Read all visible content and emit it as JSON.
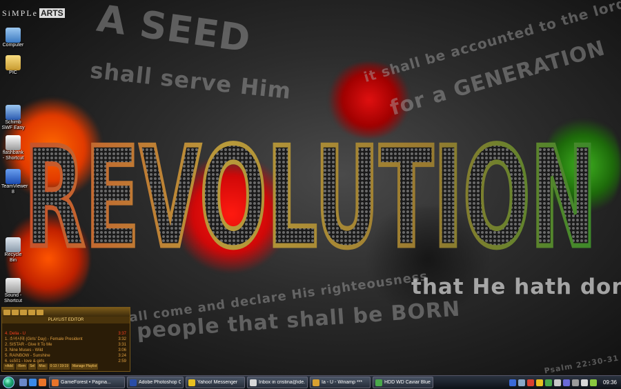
{
  "wallpaper": {
    "main_word": "REVOLUTION",
    "phrase_seed": "A SEED",
    "phrase_serve": "shall serve Him",
    "phrase_accounted": "it shall be accounted to the lord",
    "phrase_generation": "for a GENERATION",
    "phrase_declare": "shall come and declare His righteousness",
    "phrase_born": "a people that shall be BORN",
    "phrase_done": "that He hath done this",
    "phrase_psalm": "Psalm 22:30-31",
    "logo_text": "SiMPLe",
    "logo_box": "ARTS"
  },
  "desktop_icons": [
    {
      "label": "Computer",
      "icon": "computer-icon",
      "color": "#6aa6e0"
    },
    {
      "label": "PIC",
      "icon": "folder-icon",
      "color": "#e8c05a"
    },
    {
      "label": "Schimb SWF Easy",
      "icon": "swf-icon",
      "color": "#4a8ad8"
    },
    {
      "label": "flashbank - Shortcut",
      "icon": "shortcut-icon",
      "color": "#cccccc"
    },
    {
      "label": "TeamViewer 8",
      "icon": "teamviewer-icon",
      "color": "#2a6ad8"
    },
    {
      "label": "Recycle Bin",
      "icon": "recycle-bin-icon",
      "color": "#b8c8d8"
    },
    {
      "label": "Sound - Shortcut",
      "icon": "sound-icon",
      "color": "#d8d8d8"
    }
  ],
  "winamp": {
    "title": "PLAYLIST EDITOR",
    "tracks": [
      {
        "title": "4. Delia - U",
        "duration": "3:37"
      },
      {
        "title": "1. 소녀시대 (Girls' Day) - Female President",
        "duration": "3:32"
      },
      {
        "title": "2. SISTAR - Give It To Me",
        "duration": "3:31"
      },
      {
        "title": "3. Nine Muses - Wild",
        "duration": "3:06"
      },
      {
        "title": "5. RAINBOW - Sunshine",
        "duration": "3:24"
      },
      {
        "title": "6. ss501 - love & girls",
        "duration": "2:59"
      }
    ],
    "buttons": [
      "+Add",
      "-Rem",
      "Sel",
      "Misc",
      "0:13 / 19:19",
      "Manage Playlist"
    ]
  },
  "taskbar": {
    "start_label": "Start",
    "windows": [
      {
        "label": "GameForest • Pagina...",
        "icon": "firefox-icon",
        "color": "#e8742a"
      },
      {
        "label": "Adobe Photoshop C...",
        "icon": "photoshop-icon",
        "color": "#2a4ea8"
      },
      {
        "label": "Yahoo! Messenger",
        "icon": "yahoo-icon",
        "color": "#e8c020"
      },
      {
        "label": "Inbox in cristina@ide...",
        "icon": "mail-icon",
        "color": "#d8d8d8"
      },
      {
        "label": "Ia - U - Winamp ***",
        "icon": "winamp-icon",
        "color": "#d8a030"
      },
      {
        "label": "HDD WD Caviar Blue...",
        "icon": "chrome-icon",
        "color": "#4aa84a"
      }
    ],
    "clock": "09:36"
  }
}
